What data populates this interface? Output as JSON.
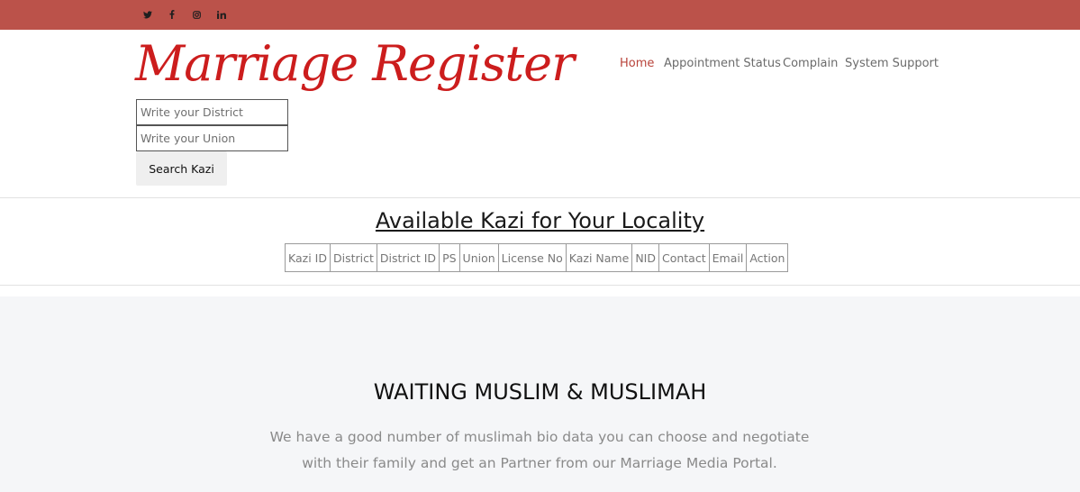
{
  "social": [
    {
      "icon": "twitter-icon",
      "glyph": "🐦"
    },
    {
      "icon": "facebook-icon",
      "glyph": "f"
    },
    {
      "icon": "instagram-icon",
      "glyph": "◎"
    },
    {
      "icon": "linkedin-icon",
      "glyph": "in"
    }
  ],
  "brand": {
    "logo_text": "Marriage Register"
  },
  "nav": {
    "home": "Home",
    "appointment": "Appointment Status",
    "complain": "Complain",
    "support": "System Support"
  },
  "search": {
    "district_placeholder": "Write your District",
    "union_placeholder": "Write your Union",
    "button_label": "Search Kazi"
  },
  "kazi": {
    "title": "Available Kazi for Your Locality",
    "columns": [
      "Kazi ID",
      "District",
      "District ID",
      "PS",
      "Union",
      "License No",
      "Kazi Name",
      "NID",
      "Contact",
      "Email",
      "Action"
    ]
  },
  "waiting": {
    "title": "WAITING MUSLIM & MUSLIMAH",
    "line1": "We have a good number of muslimah bio data you can choose and negotiate",
    "line2": "with their family and get an Partner from our Marriage Media Portal."
  },
  "colors": {
    "topbar": "#bb524a",
    "logo": "#cc1d1d",
    "nav_active": "#b8433a"
  }
}
